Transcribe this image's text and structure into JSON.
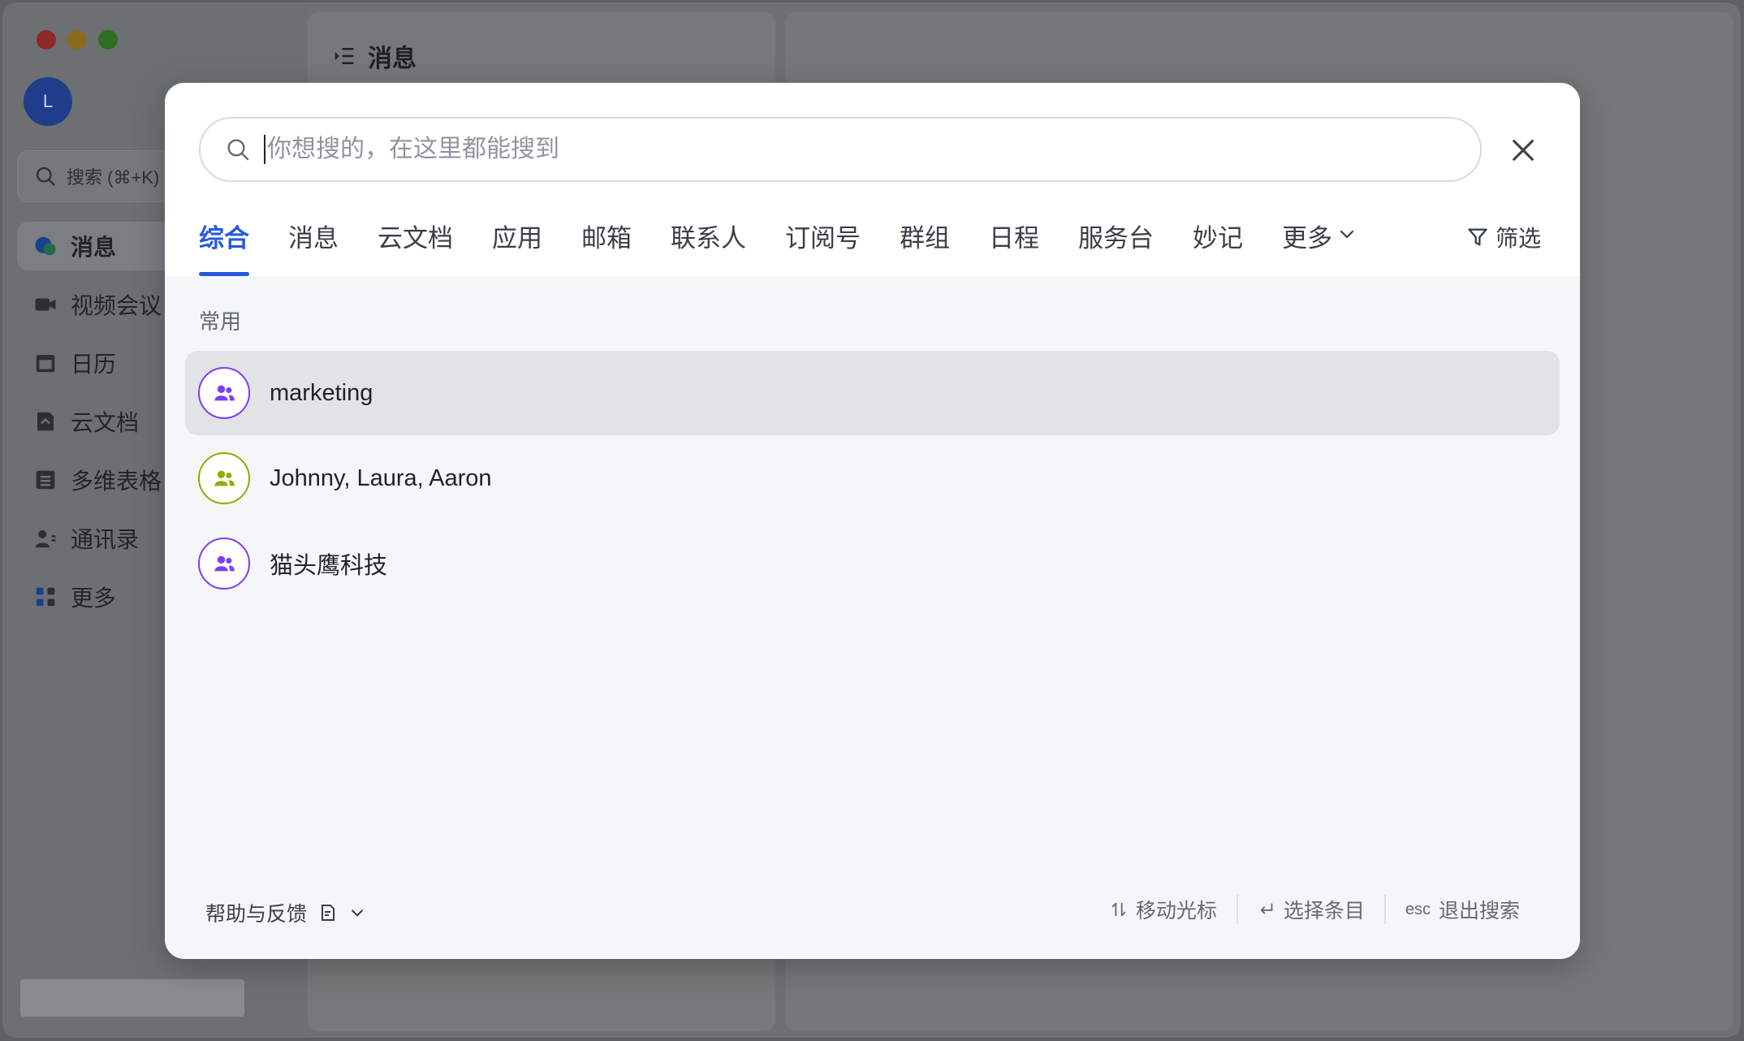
{
  "sidebar": {
    "avatar_initial": "L",
    "search_placeholder": "搜索 (⌘+K)",
    "items": [
      {
        "label": "消息",
        "icon": "message-icon"
      },
      {
        "label": "视频会议",
        "icon": "video-icon"
      },
      {
        "label": "日历",
        "icon": "calendar-icon"
      },
      {
        "label": "云文档",
        "icon": "docs-icon"
      },
      {
        "label": "多维表格",
        "icon": "base-icon"
      },
      {
        "label": "通讯录",
        "icon": "contacts-icon"
      },
      {
        "label": "更多",
        "icon": "apps-icon"
      }
    ]
  },
  "mid_panel": {
    "title": "消息"
  },
  "search_modal": {
    "placeholder": "你想搜的，在这里都能搜到",
    "value": "",
    "tabs": [
      "综合",
      "消息",
      "云文档",
      "应用",
      "邮箱",
      "联系人",
      "订阅号",
      "群组",
      "日程",
      "服务台",
      "妙记",
      "更多"
    ],
    "active_tab": "综合",
    "filter_label": "筛选",
    "section_label": "常用",
    "results": [
      {
        "name": "marketing",
        "avatar_color": "#7f3bf5",
        "selected": true
      },
      {
        "name": "Johnny, Laura, Aaron",
        "avatar_color": "#8fac02",
        "selected": false
      },
      {
        "name": "猫头鹰科技",
        "avatar_color": "#7f3bf5",
        "selected": false
      }
    ],
    "footer": {
      "help_label": "帮助与反馈",
      "hint_move": "移动光标",
      "hint_select": "选择条目",
      "hint_esc_key": "esc",
      "hint_exit": "退出搜索"
    }
  },
  "colors": {
    "accent": "#245bdb",
    "group_purple": "#7f3bf5",
    "group_green": "#8fac02"
  }
}
